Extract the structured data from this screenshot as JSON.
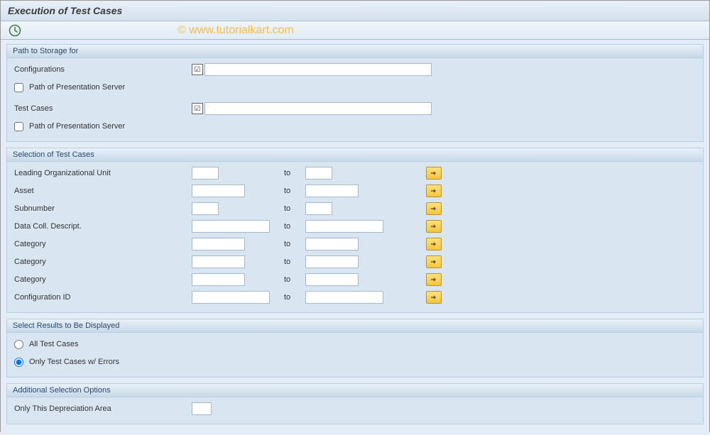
{
  "title": "Execution of Test Cases",
  "watermark": "© www.tutorialkart.com",
  "group_storage": {
    "header": "Path to Storage for",
    "configurations_label": "Configurations",
    "path_pres_server_label": "Path of Presentation Server",
    "test_cases_label": "Test Cases"
  },
  "group_selection": {
    "header": "Selection of Test Cases",
    "to_label": "to",
    "rows": [
      {
        "label": "Leading Organizational Unit",
        "size": "sm"
      },
      {
        "label": "Asset",
        "size": "md"
      },
      {
        "label": "Subnumber",
        "size": "sm"
      },
      {
        "label": "Data Coll. Descript.",
        "size": "lg"
      },
      {
        "label": "Category",
        "size": "md"
      },
      {
        "label": "Category",
        "size": "md"
      },
      {
        "label": "Category",
        "size": "md"
      },
      {
        "label": "Configuration ID",
        "size": "lg"
      }
    ]
  },
  "group_results": {
    "header": "Select Results to Be Displayed",
    "opt_all": "All Test Cases",
    "opt_errors": "Only Test Cases w/ Errors"
  },
  "group_additional": {
    "header": "Additional Selection Options",
    "depreciation_label": "Only This Depreciation Area"
  }
}
